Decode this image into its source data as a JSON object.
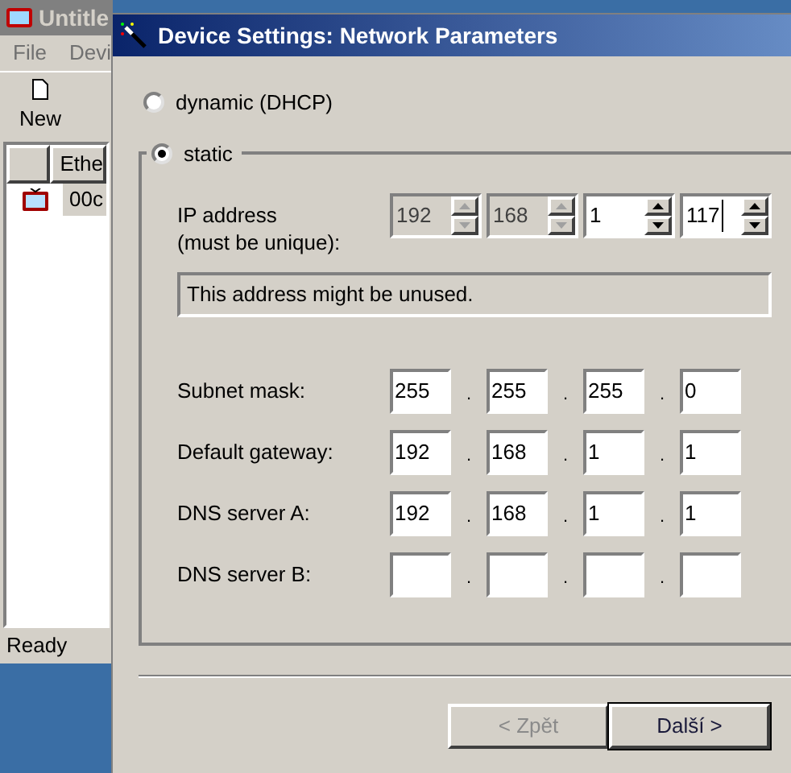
{
  "background_window": {
    "title": "Untitle",
    "menu": [
      "File",
      "Devi"
    ],
    "toolbar": [
      {
        "label": "New"
      }
    ],
    "table": {
      "columns": [
        "Ethe"
      ],
      "rows": [
        {
          "cells": [
            "00c"
          ],
          "selected": true
        }
      ]
    },
    "status_bar": "Ready"
  },
  "dialog": {
    "title": "Device Settings: Network Parameters",
    "modes": [
      {
        "label": "dynamic (DHCP)",
        "selected": false
      },
      {
        "label": "static",
        "selected": true
      }
    ],
    "ip_address": {
      "label": [
        "IP address",
        "(must be unique):"
      ],
      "octets": [
        {
          "value": "192",
          "disabled": true,
          "focused": false
        },
        {
          "value": "168",
          "disabled": true,
          "focused": false
        },
        {
          "value": "1",
          "disabled": false,
          "focused": false
        },
        {
          "value": "117",
          "disabled": false,
          "focused": true
        }
      ]
    },
    "notice": "This address might be unused.",
    "fields": [
      {
        "label": "Subnet mask:",
        "octets": [
          {
            "value": "255"
          },
          {
            "value": "255"
          },
          {
            "value": "255"
          },
          {
            "value": "0"
          }
        ],
        "separators": [
          ".",
          ".",
          "."
        ]
      },
      {
        "label": "Default gateway:",
        "octets": [
          {
            "value": "192"
          },
          {
            "value": "168"
          },
          {
            "value": "1"
          },
          {
            "value": "1"
          }
        ],
        "separators": [
          ".",
          ".",
          "."
        ]
      },
      {
        "label": "DNS server A:",
        "octets": [
          {
            "value": "192"
          },
          {
            "value": "168"
          },
          {
            "value": "1"
          },
          {
            "value": "1"
          }
        ],
        "separators": [
          ".",
          ".",
          "."
        ]
      },
      {
        "label": "DNS server B:",
        "octets": [
          {
            "blank": true
          },
          {
            "blank": true
          },
          {
            "blank": true
          },
          {
            "blank": true
          }
        ],
        "separators": [
          ".",
          ".",
          "."
        ]
      }
    ],
    "buttons": [
      {
        "label": "< Zpět",
        "disabled": true,
        "default": false
      },
      {
        "label": "Další >",
        "disabled": false,
        "default": true
      }
    ]
  }
}
